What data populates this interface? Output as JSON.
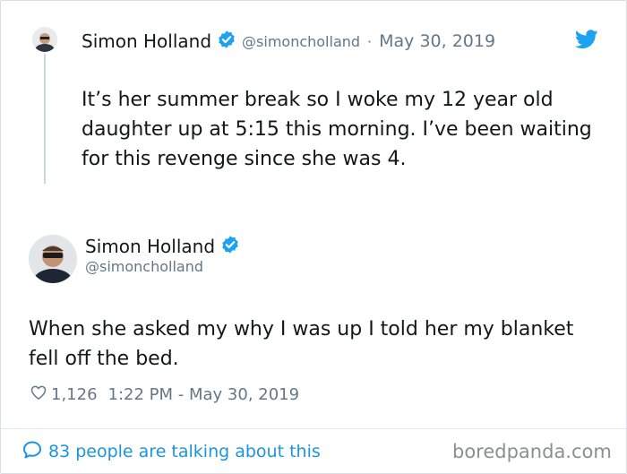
{
  "parent_tweet": {
    "author_name": "Simon Holland",
    "handle": "@simoncholland",
    "separator": "·",
    "date": "May 30, 2019",
    "text": "It’s her summer break so I woke my 12 year old daughter up at 5:15 this morning. I’ve been waiting for this revenge since she was 4."
  },
  "main_tweet": {
    "author_name": "Simon Holland",
    "handle": "@simoncholland",
    "text": "When she asked my why I was up I told her my blanket fell off the bed.",
    "likes": "1,126",
    "timestamp": "1:22 PM - May 30, 2019"
  },
  "footer": {
    "conversation_link": "83 people are talking about this",
    "watermark": "boredpanda.com"
  },
  "colors": {
    "twitter_blue": "#1da1f2",
    "link_blue": "#1b95e0",
    "muted_gray": "#657786",
    "text_dark": "#14171a"
  },
  "icons": {
    "verified": "verified-badge-icon",
    "brand": "twitter-bird-icon",
    "like": "heart-icon",
    "reply": "speech-bubble-icon"
  }
}
